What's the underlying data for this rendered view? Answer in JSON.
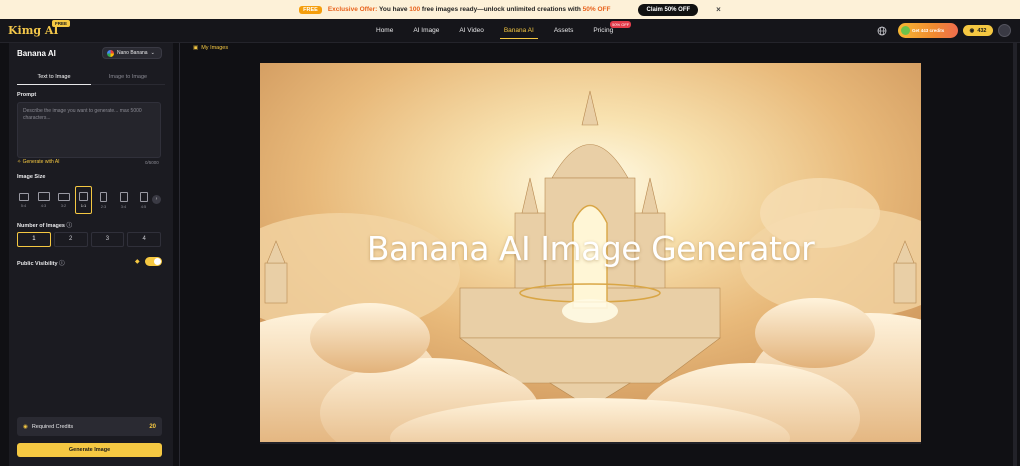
{
  "promo": {
    "free_tag": "FREE",
    "offer_label": "Exclusive Offer:",
    "text_a": "You have",
    "count": "100",
    "text_b": "free images ready—unlock unlimited creations with",
    "discount": "50% OFF",
    "claim_label": "Claim 50% OFF",
    "close_glyph": "×"
  },
  "nav": {
    "logo": "Kimg AI",
    "logo_badge": "FREE",
    "links": [
      {
        "label": "Home"
      },
      {
        "label": "AI Image"
      },
      {
        "label": "AI Video"
      },
      {
        "label": "Banana AI"
      },
      {
        "label": "Assets"
      },
      {
        "label": "Pricing",
        "badge": "50% OFF"
      }
    ],
    "active": "Banana AI",
    "promo_pill": "Get 443 credits",
    "credits": "432"
  },
  "sidebar": {
    "title": "Banana AI",
    "model": "Nano Banana",
    "tabs": [
      "Text to Image",
      "Image to Image"
    ],
    "prompt_label": "Prompt",
    "prompt_placeholder": "Describe the image you want to generate... max 5000 characters...",
    "generate_ai_label": "Generate with AI",
    "char_count": "0/5000",
    "image_size_label": "Image Size",
    "sizes": [
      "5:4",
      "4:3",
      "3:2",
      "1:1",
      "2:3",
      "3:4",
      "4:5"
    ],
    "selected_size": "1:1",
    "num_images_label": "Number of Images",
    "num_options": [
      "1",
      "2",
      "3",
      "4"
    ],
    "selected_num": "1",
    "visibility_label": "Public Visibility",
    "required_credits_label": "Required Credits",
    "required_credits_value": "20",
    "generate_button": "Generate Image"
  },
  "main": {
    "my_images_label": "My Images",
    "hero_title": "Banana AI Image Generator"
  },
  "colors": {
    "accent": "#f5c842",
    "background": "#101014",
    "panel": "#1b1b21"
  }
}
